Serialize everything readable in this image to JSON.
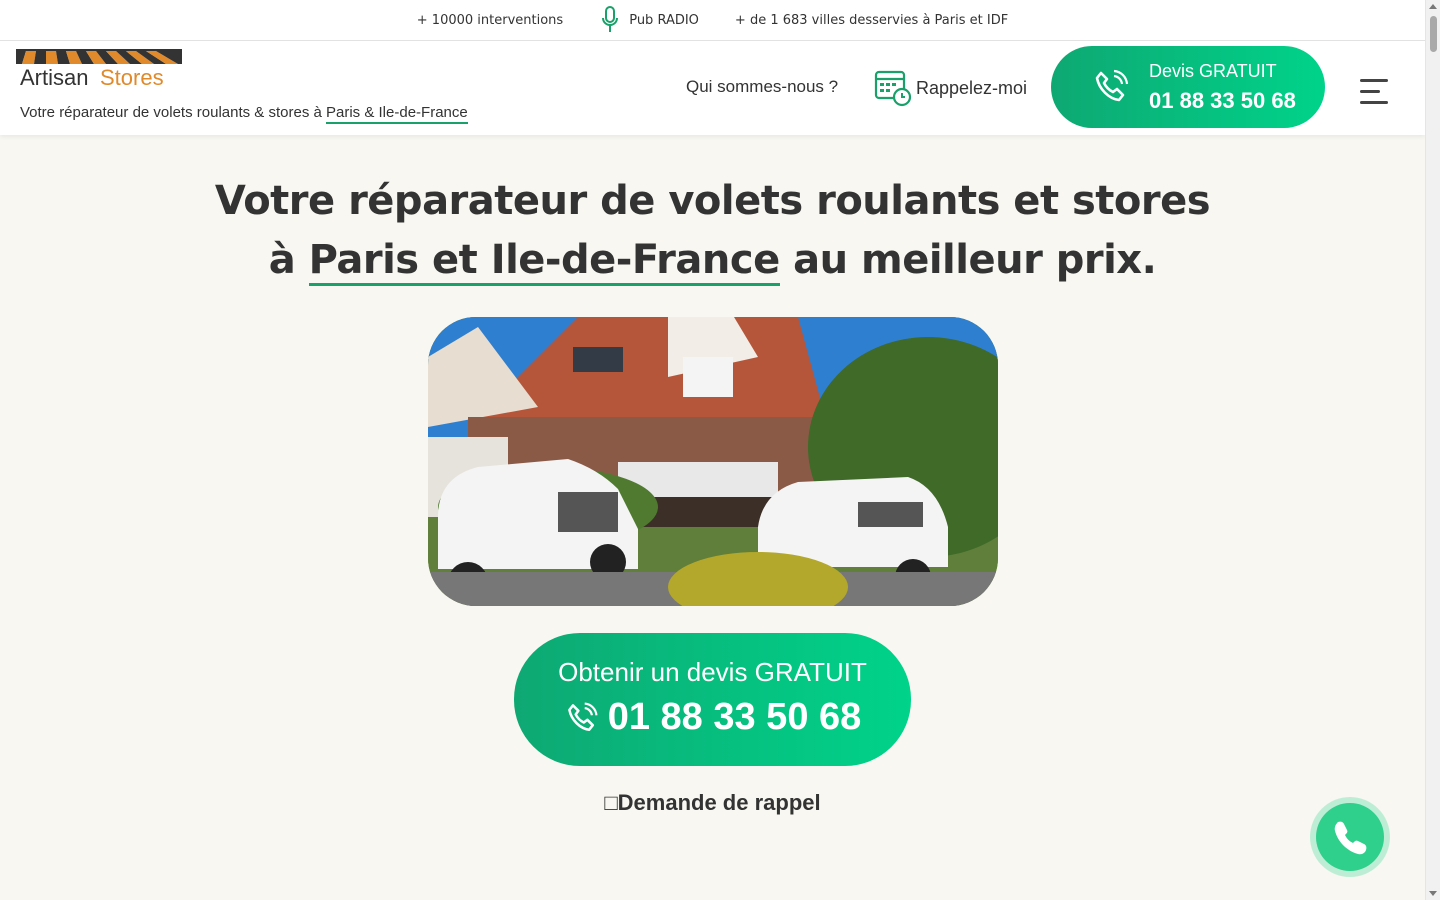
{
  "topbar": {
    "interventions": "+ 10000 interventions",
    "radio": "Pub RADIO",
    "cities": "+ de 1 683 villes desservies à Paris et IDF"
  },
  "header": {
    "logo_part1": "Artisan",
    "logo_part2": "Stores",
    "tagline_prefix": "Votre réparateur de volets roulants & stores à ",
    "tagline_link": "Paris & Ile-de-France",
    "nav_about": "Qui sommes-nous ?",
    "callback_label": "Rappelez-moi",
    "cta_label": "Devis GRATUIT",
    "cta_phone": "01 88 33 50 68"
  },
  "hero": {
    "title_line1": "Votre réparateur de volets roulants et stores",
    "title_line2_prefix": "à ",
    "title_line2_highlight": "Paris et Ile-de-France",
    "title_line2_suffix": " au meilleur prix.",
    "image_alt": "Artisan Stores vans in front of a house"
  },
  "main_cta": {
    "label": "Obtenir un devis GRATUIT",
    "phone": "01 88 33 50 68"
  },
  "recall_link": "□Demande de rappel",
  "colors": {
    "accent_green": "#0ea873",
    "accent_green_light": "#00d38a",
    "logo_orange": "#e08a2b",
    "background": "#f8f7f1"
  },
  "icons": {
    "radio": "microphone-icon",
    "callback": "calendar-clock-icon",
    "phone": "phone-icon",
    "menu": "hamburger-menu-icon"
  }
}
